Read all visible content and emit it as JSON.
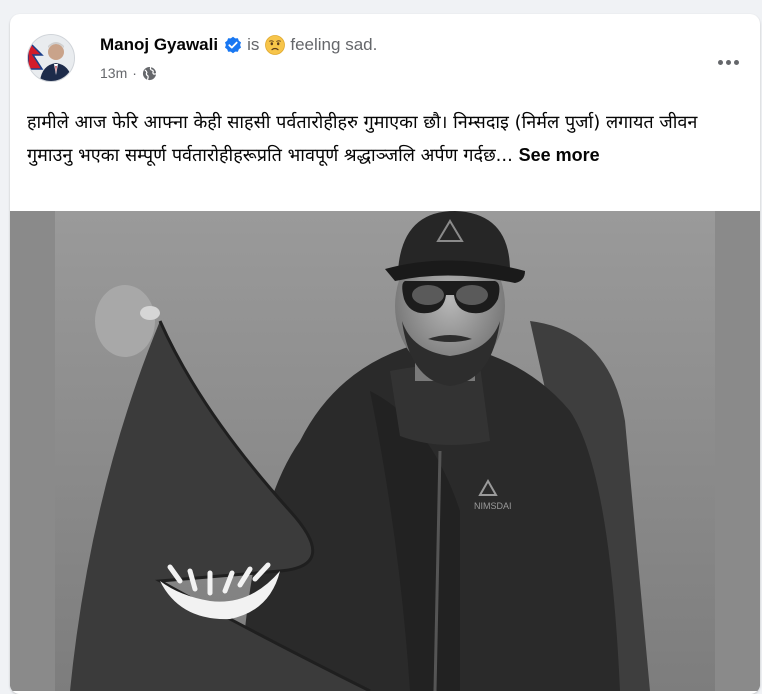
{
  "post": {
    "author": "Manoj Gyawali",
    "is_text": "is",
    "emoji_icon": "sad-face-emoji",
    "feeling_text": "feeling sad.",
    "time": "13m",
    "separator": "·",
    "audience_icon": "globe-icon",
    "body_text": "हामीले आज फेरि आफ्ना केही साहसी पर्वतारोहीहरु गुमाएका छौ। निम्सदाइ (निर्मल पुर्जा) लगायत जीवन गुमाउनु भएका सम्पूर्ण पर्वतारोहीहरूप्रति भावपूर्ण श्रद्धाञ्जलि अर्पण गर्दछ...",
    "see_more": "See more",
    "photo_jacket_logo": "NIMSDAI"
  },
  "colors": {
    "verified_blue": "#1877f2",
    "secondary_text": "#65676b",
    "primary_text": "#050505"
  }
}
